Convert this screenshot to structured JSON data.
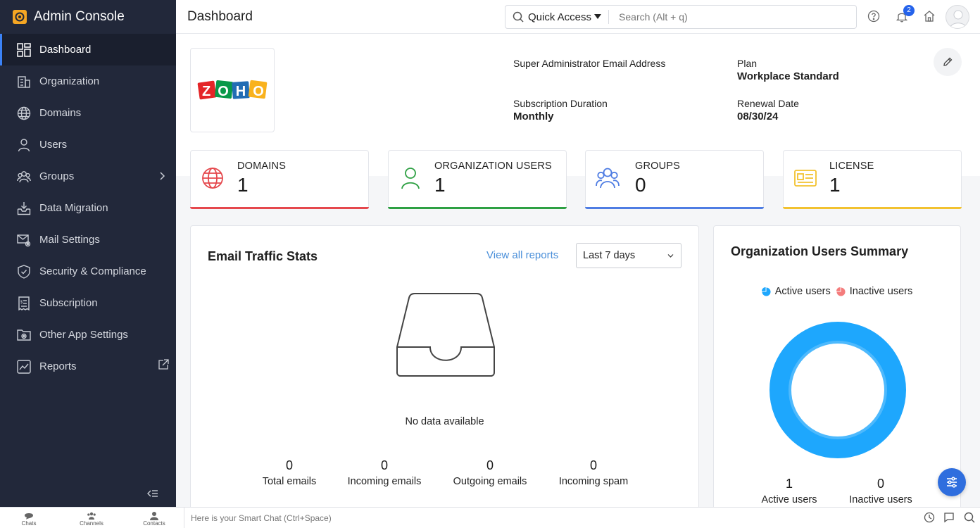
{
  "app": {
    "title": "Admin Console"
  },
  "sidebar": {
    "items": [
      {
        "label": "Dashboard",
        "icon": "dashboard-icon",
        "active": true
      },
      {
        "label": "Organization",
        "icon": "building-icon"
      },
      {
        "label": "Domains",
        "icon": "globe-icon"
      },
      {
        "label": "Users",
        "icon": "user-icon"
      },
      {
        "label": "Groups",
        "icon": "group-icon",
        "has_submenu": true
      },
      {
        "label": "Data Migration",
        "icon": "inbox-download-icon"
      },
      {
        "label": "Mail Settings",
        "icon": "mail-gear-icon"
      },
      {
        "label": "Security & Compliance",
        "icon": "shield-check-icon"
      },
      {
        "label": "Subscription",
        "icon": "receipt-icon"
      },
      {
        "label": "Other App Settings",
        "icon": "folder-gear-icon"
      },
      {
        "label": "Reports",
        "icon": "chart-line-icon",
        "external": true
      }
    ]
  },
  "header": {
    "page_title": "Dashboard",
    "quick_access": "Quick Access",
    "search_placeholder": "Search (Alt + q)",
    "notification_count": "2"
  },
  "org": {
    "logo_text": "ZOHO",
    "super_admin_label": "Super Administrator Email Address",
    "plan_label": "Plan",
    "plan_value": "Workplace Standard",
    "duration_label": "Subscription Duration",
    "duration_value": "Monthly",
    "renewal_label": "Renewal Date",
    "renewal_value": "08/30/24"
  },
  "stats": [
    {
      "label": "DOMAINS",
      "value": "1",
      "color": "#e5484d",
      "icon": "globe-icon"
    },
    {
      "label": "ORGANIZATION USERS",
      "value": "1",
      "color": "#2ea043",
      "icon": "user-icon"
    },
    {
      "label": "GROUPS",
      "value": "0",
      "color": "#4f7de3",
      "icon": "group-icon"
    },
    {
      "label": "LICENSE",
      "value": "1",
      "color": "#f2c230",
      "icon": "license-card-icon"
    }
  ],
  "email_traffic": {
    "title": "Email Traffic Stats",
    "view_all": "View all reports",
    "range": "Last 7 days",
    "empty_text": "No data available",
    "metrics": [
      {
        "value": "0",
        "label": "Total emails"
      },
      {
        "value": "0",
        "label": "Incoming emails"
      },
      {
        "value": "0",
        "label": "Outgoing emails"
      },
      {
        "value": "0",
        "label": "Incoming spam"
      }
    ]
  },
  "users_summary": {
    "title": "Organization Users Summary",
    "legend_active": "Active users",
    "legend_inactive": "Inactive users",
    "active_color": "#1ea7fd",
    "inactive_color": "#f47c7c",
    "active_value": "1",
    "active_label": "Active users",
    "inactive_value": "0",
    "inactive_label": "Inactive users"
  },
  "bottom_bar": {
    "tabs": [
      "Chats",
      "Channels",
      "Contacts"
    ],
    "smart_chat_placeholder": "Here is your Smart Chat (Ctrl+Space)"
  }
}
